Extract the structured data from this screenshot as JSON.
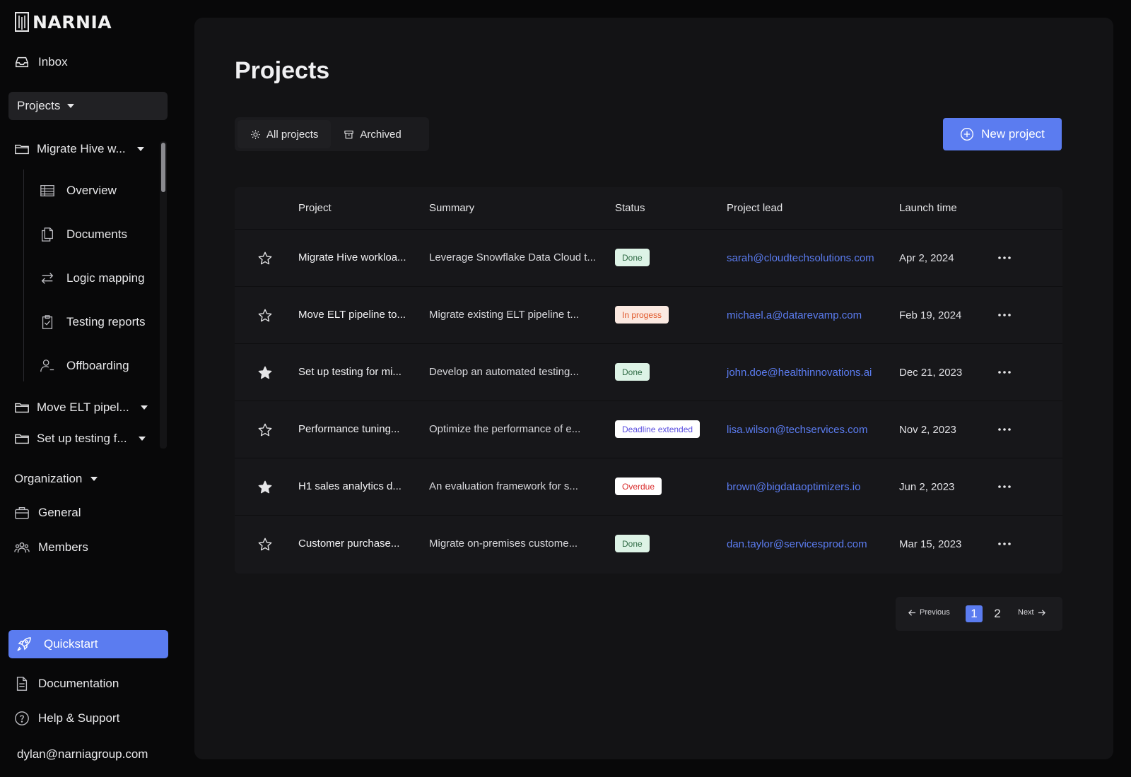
{
  "brand": {
    "name": "NARNIA"
  },
  "sidebar": {
    "inbox": "Inbox",
    "projects_select": "Projects",
    "folders": [
      {
        "label": "Migrate Hive w..."
      },
      {
        "label": "Move ELT pipel..."
      },
      {
        "label": "Set up testing f..."
      }
    ],
    "sub_items": [
      {
        "label": "Overview",
        "icon": "table-icon"
      },
      {
        "label": "Documents",
        "icon": "documents-icon"
      },
      {
        "label": "Logic mapping",
        "icon": "arrows-swap-icon"
      },
      {
        "label": "Testing reports",
        "icon": "clipboard-check-icon"
      },
      {
        "label": "Offboarding",
        "icon": "user-remove-icon"
      }
    ],
    "organization": "Organization",
    "org_items": [
      {
        "label": "General",
        "icon": "briefcase-icon"
      },
      {
        "label": "Members",
        "icon": "users-icon"
      }
    ],
    "quickstart": "Quickstart",
    "documentation": "Documentation",
    "help": "Help & Support",
    "user_email": "dylan@narniagroup.com"
  },
  "main": {
    "title": "Projects",
    "tabs": [
      {
        "label": "All projects",
        "icon": "sun-icon"
      },
      {
        "label": "Archived",
        "icon": "archive-icon"
      }
    ],
    "new_project": "New project",
    "table": {
      "headers": [
        "Project",
        "Summary",
        "Status",
        "Project lead",
        "Launch time"
      ],
      "rows": [
        {
          "starred": false,
          "project": "Migrate Hive workloa...",
          "summary": "Leverage Snowflake Data Cloud t...",
          "status": "Done",
          "status_type": "done",
          "lead": "sarah@cloudtechsolutions.com",
          "launch": "Apr 2, 2024"
        },
        {
          "starred": false,
          "project": "Move ELT pipeline to...",
          "summary": "Migrate existing ELT pipeline t...",
          "status": "In progess",
          "status_type": "prog",
          "lead": "michael.a@datarevamp.com",
          "launch": "Feb 19, 2024"
        },
        {
          "starred": true,
          "project": "Set up testing for mi...",
          "summary": "Develop an automated testing...",
          "status": "Done",
          "status_type": "done",
          "lead": "john.doe@healthinnovations.ai",
          "launch": "Dec 21, 2023"
        },
        {
          "starred": false,
          "project": "Performance tuning...",
          "summary": "Optimize the performance of e...",
          "status": "Deadline extended",
          "status_type": "ext",
          "lead": "lisa.wilson@techservices.com",
          "launch": "Nov 2, 2023"
        },
        {
          "starred": true,
          "project": "H1 sales analytics d...",
          "summary": "An evaluation framework for s...",
          "status": "Overdue",
          "status_type": "over",
          "lead": "brown@bigdataoptimizers.io",
          "launch": "Jun 2, 2023"
        },
        {
          "starred": false,
          "project": "Customer purchase...",
          "summary": "Migrate on-premises custome...",
          "status": "Done",
          "status_type": "done",
          "lead": "dan.taylor@servicesprod.com",
          "launch": "Mar 15, 2023"
        }
      ]
    },
    "pagination": {
      "previous": "Previous",
      "next": "Next",
      "pages": [
        "1",
        "2"
      ],
      "current": "1"
    }
  },
  "colors": {
    "accent": "#5b7cf0",
    "background": "#080809",
    "panel": "#131315"
  }
}
